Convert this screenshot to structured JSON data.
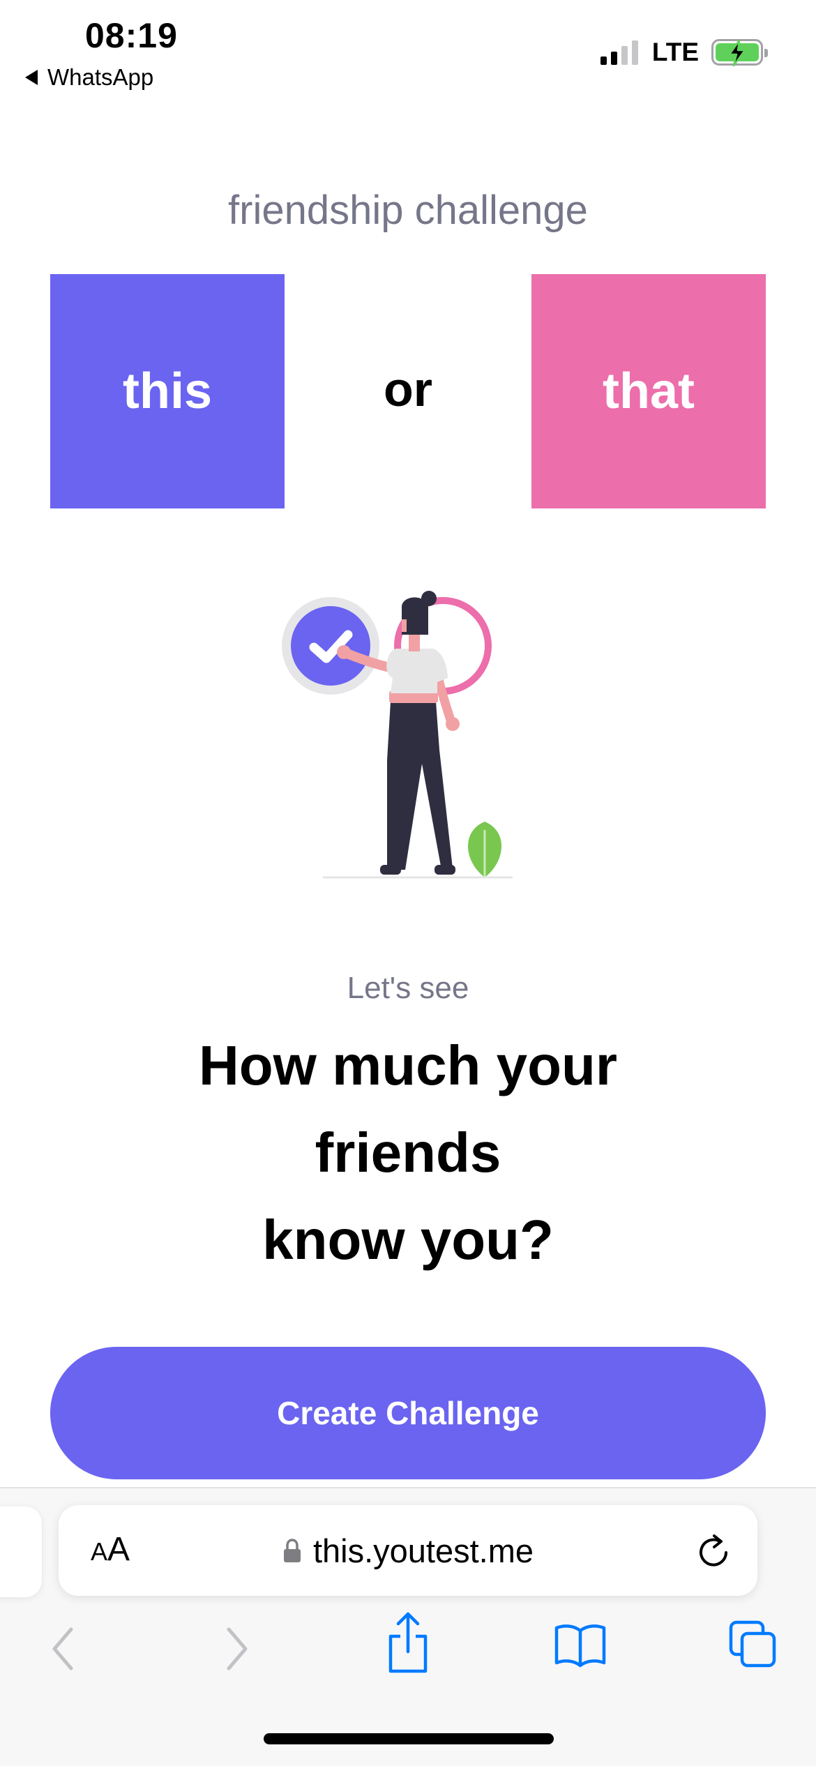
{
  "status_bar": {
    "time": "08:19",
    "back_app": "WhatsApp",
    "network": "LTE",
    "signal_icon": "cellular-signal-icon",
    "battery_icon": "battery-charging-icon"
  },
  "page": {
    "subtitle": "friendship challenge",
    "choice_left": "this",
    "choice_middle": "or",
    "choice_right": "that",
    "illustration_icon": "woman-checkmark-illustration",
    "lead": "Let's see",
    "headline_lines": [
      "How much your",
      "friends",
      "know you?"
    ],
    "cta_label": "Create Challenge"
  },
  "browser": {
    "text_size_label_small": "A",
    "text_size_label_large": "A",
    "url": "this.youtest.me",
    "lock_icon": "lock-icon",
    "reload_icon": "reload-icon",
    "toolbar_icons": [
      "back-icon",
      "forward-icon",
      "share-icon",
      "bookmarks-icon",
      "tabs-icon"
    ]
  },
  "colors": {
    "primary": "#6a64f1",
    "pink": "#ec6eab",
    "muted_text": "#76768a",
    "ios_blue": "#007aff",
    "leaf_green": "#7ac74f"
  }
}
